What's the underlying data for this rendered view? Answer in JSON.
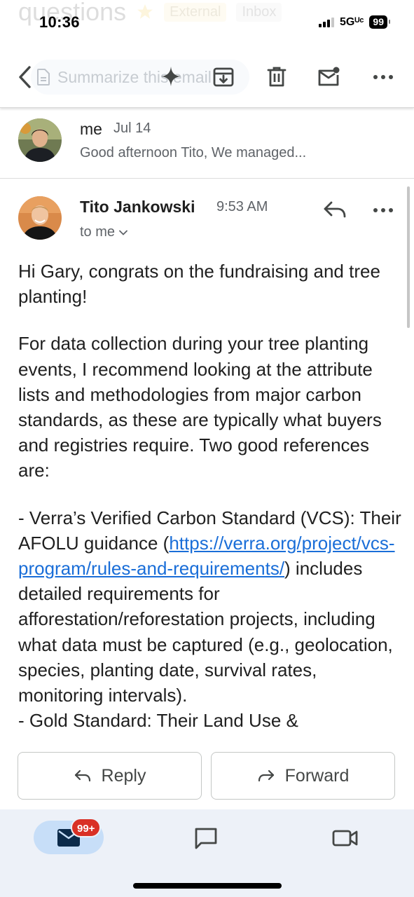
{
  "ghost_header": {
    "subject": "questions",
    "labels": [
      "External",
      "Inbox"
    ]
  },
  "status_bar": {
    "time": "10:36",
    "network": "5Gᵁᶜ",
    "battery": "99"
  },
  "toolbar": {
    "summarize_text": "Summarize this email",
    "icons": [
      "back-icon",
      "summarize-icon",
      "archive-icon",
      "delete-icon",
      "mark-unread-icon",
      "more-icon"
    ]
  },
  "collapsed_message": {
    "sender": "me",
    "date": "Jul 14",
    "snippet": "Good afternoon Tito, We managed..."
  },
  "open_message": {
    "sender": "Tito Jankowski",
    "time": "9:53 AM",
    "recipient": "to me",
    "greeting": "Hi Gary, congrats on the fundraising and tree planting!",
    "body_paragraph_1": "For data collection during your tree planting events, I recommend looking at the attribute lists and methodologies from major carbon standards, as these are typically what buyers and registries require. Two good references are:",
    "bullet_1_prefix": "- Verra’s Verified Carbon Standard (VCS): Their AFOLU guidance (",
    "bullet_1_link": "https://verra.org/project/vcs-program/rules-and-requirements/",
    "bullet_1_suffix": ") includes detailed requirements for afforestation/reforestation projects, including what data must be captured (e.g., geolocation, species, planting date, survival rates, monitoring intervals).",
    "bullet_2_partial": "- Gold Standard: Their Land Use &"
  },
  "actions": {
    "reply": "Reply",
    "forward": "Forward"
  },
  "bottom_nav": {
    "mail_badge": "99+",
    "items": [
      "mail-icon",
      "chat-icon",
      "meet-icon"
    ]
  },
  "colors": {
    "link": "#1a6ed8",
    "badge": "#d93025",
    "nav_active": "#c7def8",
    "nav_bg": "#edf1f8"
  }
}
